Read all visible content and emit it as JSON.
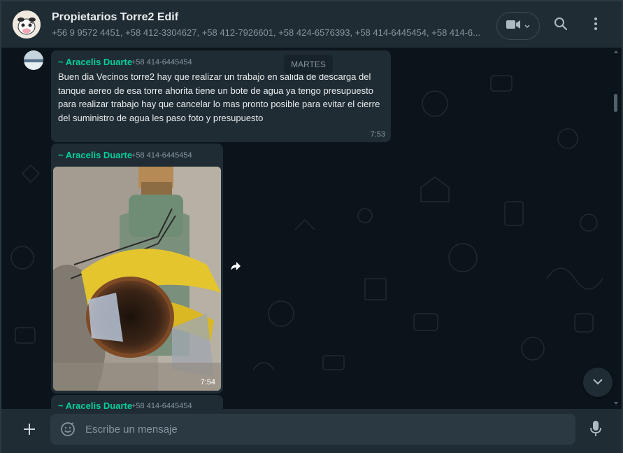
{
  "header": {
    "title": "Propietarios Torre2 Edif",
    "subtitle": "+56 9 9572 4451, +58 412-3304627, +58 412-7926601, +58 424-6576393, +58 414-6445454, +58 414-6..."
  },
  "day_chip": "MARTES",
  "messages": [
    {
      "sender": "~ Aracelis Duarte",
      "phone": "+58 414-6445454",
      "text": "Buen dia Vecinos torre2 hay que realizar un trabajo en salida de descarga del tanque aereo de esa torre ahorita tiene un bote de agua ya tengo presupuesto para realizar trabajo hay que cancelar lo mas pronto posible para evitar el  cierre del suministro de agua les paso foto y presupuesto",
      "time": "7:53"
    },
    {
      "sender": "~ Aracelis Duarte",
      "phone": "+58 414-6445454",
      "time": "7:54"
    },
    {
      "sender": "~ Aracelis Duarte",
      "phone": "+58 414-6445454"
    }
  ],
  "composer": {
    "placeholder": "Escribe un mensaje"
  },
  "icons": {
    "video": "video-camera-icon",
    "search": "search-icon",
    "menu": "more-vertical-icon",
    "attach": "plus-icon",
    "emoji": "emoji-icon",
    "mic": "microphone-icon",
    "forward": "forward-icon",
    "scroll_down": "chevron-down-icon"
  },
  "colors": {
    "background": "#0b141a",
    "panel": "#202c33",
    "bubble": "#202c33",
    "sender": "#06cf9c",
    "secondary_text": "#8696a0"
  }
}
